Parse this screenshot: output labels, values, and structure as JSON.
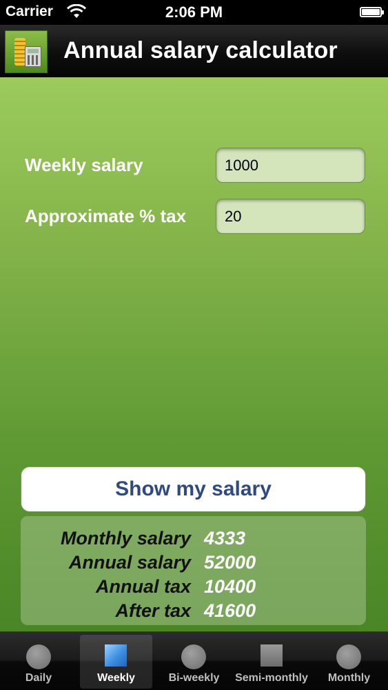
{
  "status_bar": {
    "carrier": "Carrier",
    "time": "2:06 PM",
    "wifi_icon": "wifi-icon",
    "battery_icon": "battery-icon"
  },
  "header": {
    "title": "Annual salary calculator",
    "app_icon": "salary-calculator-icon"
  },
  "form": {
    "salary_label": "Weekly salary",
    "salary_value": "1000",
    "tax_label": "Approximate % tax",
    "tax_value": "20"
  },
  "button": {
    "label": "Show my salary"
  },
  "results": [
    {
      "label": "Monthly salary",
      "value": "4333"
    },
    {
      "label": "Annual salary",
      "value": "52000"
    },
    {
      "label": "Annual tax",
      "value": "10400"
    },
    {
      "label": "After tax",
      "value": "41600"
    }
  ],
  "tabs": [
    {
      "label": "Daily",
      "icon": "circle-icon",
      "active": false
    },
    {
      "label": "Weekly",
      "icon": "square-icon",
      "active": true
    },
    {
      "label": "Bi-weekly",
      "icon": "circle-icon",
      "active": false
    },
    {
      "label": "Semi-monthly",
      "icon": "square-icon",
      "active": false
    },
    {
      "label": "Monthly",
      "icon": "circle-icon",
      "active": false
    }
  ],
  "colors": {
    "content_top": "#9ccb5c",
    "content_bottom": "#4a8626",
    "button_text": "#2f4a80",
    "input_bg": "#d4e5bc",
    "active_tab_icon": "#3d8fe0"
  }
}
